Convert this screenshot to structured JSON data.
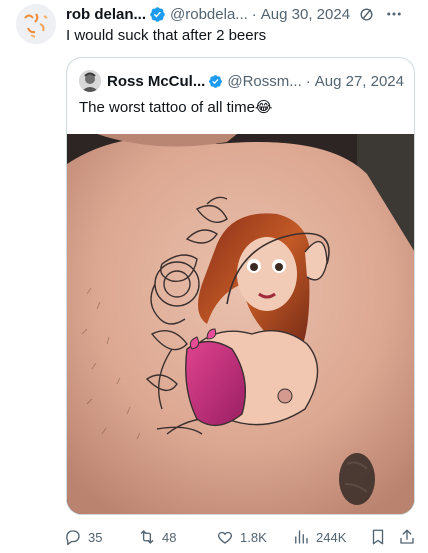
{
  "tweet": {
    "author": {
      "display_name": "rob delan...",
      "handle": "@robdela...",
      "avatar_icon": "orange-sketch-avatar",
      "verified": true
    },
    "date": "Aug 30, 2024",
    "dot": "·",
    "text": "I would suck that after 2 beers",
    "quote": {
      "author": {
        "display_name": "Ross McCul...",
        "handle": "@Rossm...",
        "verified": true
      },
      "date": "Aug 27, 2024",
      "dot": "·",
      "text": "The worst tattoo of all time😂",
      "media_icon": "chest-tattoo-photo"
    },
    "actions": {
      "replies": "35",
      "reposts": "48",
      "likes": "1.8K",
      "views": "244K"
    }
  },
  "colors": {
    "text_primary": "#0f1419",
    "text_secondary": "#536471",
    "verified_blue": "#1d9bf0",
    "border": "#cfd9de"
  }
}
